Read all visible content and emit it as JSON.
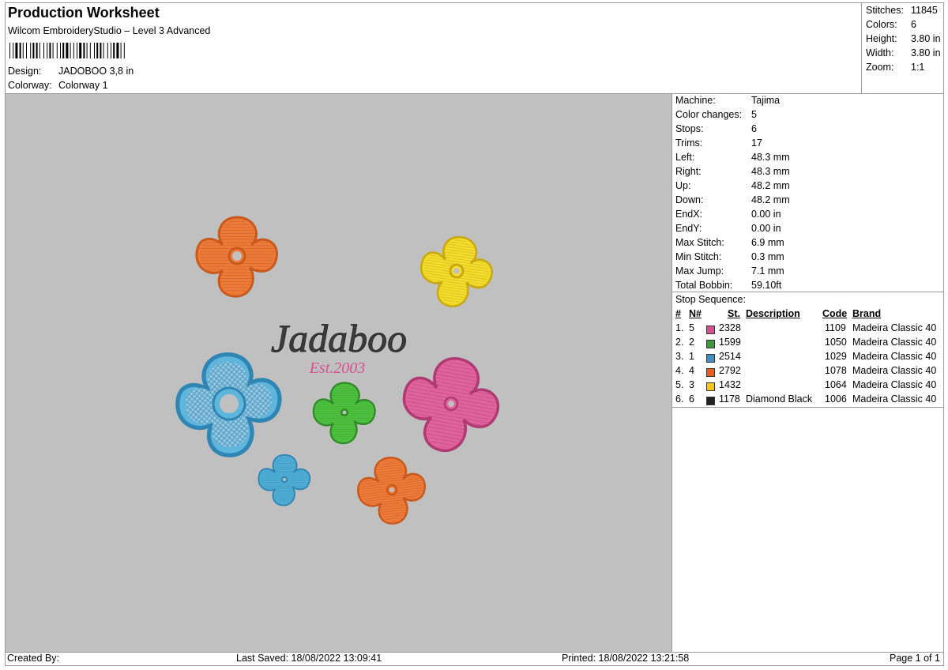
{
  "header": {
    "title": "Production Worksheet",
    "subtitle": "Wilcom EmbroideryStudio – Level 3 Advanced",
    "design_label": "Design:",
    "design_value": "JADOBOO 3,8 in",
    "colorway_label": "Colorway:",
    "colorway_value": "Colorway 1"
  },
  "summary": [
    {
      "label": "Stitches:",
      "value": "11845"
    },
    {
      "label": "Colors:",
      "value": "6"
    },
    {
      "label": "Height:",
      "value": "3.80 in"
    },
    {
      "label": "Width:",
      "value": "3.80 in"
    },
    {
      "label": "Zoom:",
      "value": "1:1"
    }
  ],
  "machine_stats": [
    {
      "label": "Machine:",
      "value": "Tajima"
    },
    {
      "label": "Color changes:",
      "value": "5"
    },
    {
      "label": "Stops:",
      "value": "6"
    },
    {
      "label": "Trims:",
      "value": "17"
    },
    {
      "label": "Left:",
      "value": "48.3 mm"
    },
    {
      "label": "Right:",
      "value": "48.3 mm"
    },
    {
      "label": "Up:",
      "value": "48.2 mm"
    },
    {
      "label": "Down:",
      "value": "48.2 mm"
    },
    {
      "label": "EndX:",
      "value": "0.00 in"
    },
    {
      "label": "EndY:",
      "value": "0.00 in"
    },
    {
      "label": "Max Stitch:",
      "value": "6.9 mm"
    },
    {
      "label": "Min Stitch:",
      "value": "0.3 mm"
    },
    {
      "label": "Max Jump:",
      "value": "7.1 mm"
    },
    {
      "label": "Total Bobbin:",
      "value": "59.10ft"
    }
  ],
  "stop_sequence": {
    "title": "Stop Sequence:",
    "headers": {
      "num": "#",
      "n": "N#",
      "st": "St.",
      "desc": "Description",
      "code": "Code",
      "brand": "Brand"
    },
    "rows": [
      {
        "num": "1.",
        "n": "5",
        "color": "#d94f8e",
        "st": "2328",
        "desc": "",
        "code": "1109",
        "brand": "Madeira Classic 40"
      },
      {
        "num": "2.",
        "n": "2",
        "color": "#3a9a3a",
        "st": "1599",
        "desc": "",
        "code": "1050",
        "brand": "Madeira Classic 40"
      },
      {
        "num": "3.",
        "n": "1",
        "color": "#3d8fc4",
        "st": "2514",
        "desc": "",
        "code": "1029",
        "brand": "Madeira Classic 40"
      },
      {
        "num": "4.",
        "n": "4",
        "color": "#f05a1e",
        "st": "2792",
        "desc": "",
        "code": "1078",
        "brand": "Madeira Classic 40"
      },
      {
        "num": "5.",
        "n": "3",
        "color": "#f5c518",
        "st": "1432",
        "desc": "",
        "code": "1064",
        "brand": "Madeira Classic 40"
      },
      {
        "num": "6.",
        "n": "6",
        "color": "#222222",
        "st": "1178",
        "desc": "Diamond Black",
        "code": "1006",
        "brand": "Madeira Classic 40"
      }
    ]
  },
  "design": {
    "main_text": "Jadaboo",
    "est_text": "Est.2003",
    "canvas_color": "#c0c0c0"
  },
  "footer": {
    "created_by": "Created By:",
    "last_saved": "Last Saved: 18/08/2022 13:09:41",
    "printed": "Printed: 18/08/2022 13:21:58",
    "page": "Page 1 of 1"
  }
}
